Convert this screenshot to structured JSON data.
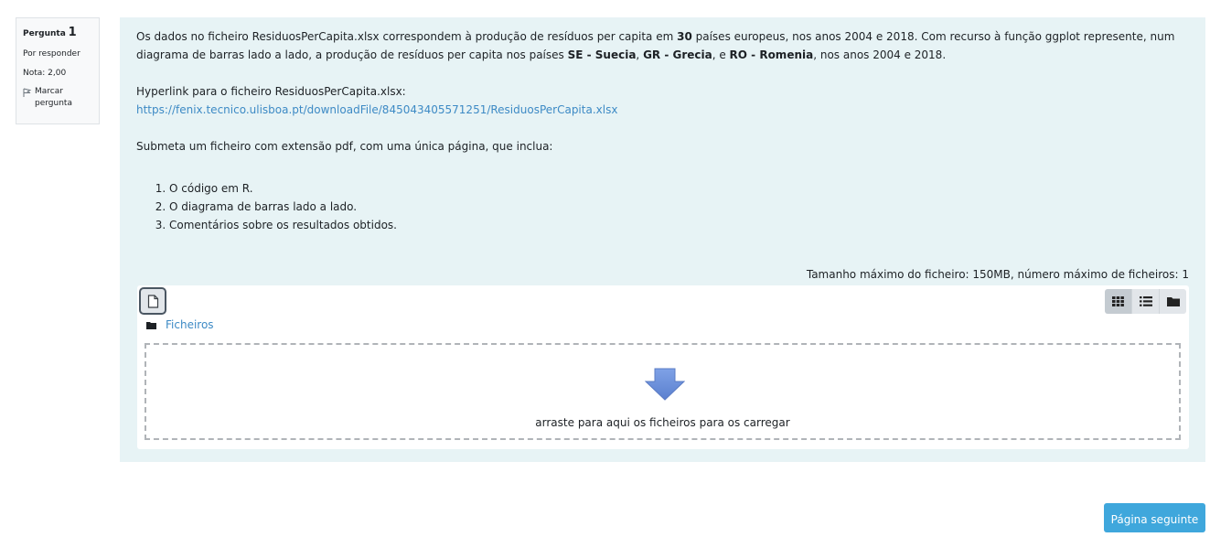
{
  "question_info": {
    "label": "Pergunta",
    "number": "1",
    "status": "Por responder",
    "grade": "Nota: 2,00",
    "flag_label": "Marcar pergunta"
  },
  "question_text": {
    "para1_part1": "Os dados no ficheiro ResiduosPerCapita.xlsx correspondem à produção de resíduos per capita em ",
    "para1_bold1": "30",
    "para1_part2": " países europeus, nos anos 2004 e 2018. Com recurso à função ggplot represente, num diagrama de barras lado a lado, a produção de resíduos per capita nos países ",
    "para1_bold2": "SE - Suecia",
    "para1_sep1": ", ",
    "para1_bold3": "GR - Grecia",
    "para1_sep2": ", e ",
    "para1_bold4": "RO - Romenia",
    "para1_part3": ", nos anos 2004 e 2018.",
    "hyperlink_label": "Hyperlink para o ficheiro ResiduosPerCapita.xlsx:",
    "hyperlink_url": "https://fenix.tecnico.ulisboa.pt/downloadFile/845043405571251/ResiduosPerCapita.xlsx",
    "submit_instructions": "Submeta um ficheiro com extensão pdf, com uma única página, que inclua:",
    "items": [
      "O código em R.",
      "O diagrama de barras lado a lado.",
      "Comentários sobre os resultados obtidos."
    ]
  },
  "file_limits": "Tamanho máximo do ficheiro: 150MB, número máximo de ficheiros: 1",
  "filemanager": {
    "add_file_icon": "file-icon",
    "view_buttons": [
      "grid-view-icon",
      "list-view-icon",
      "folder-view-icon"
    ],
    "breadcrumb_icon": "folder-icon",
    "breadcrumb_label": "Ficheiros",
    "drop_icon": "down-arrow-icon",
    "drop_text": "arraste para aqui os ficheiros para os carregar"
  },
  "navigation": {
    "next_button": "Página seguinte"
  },
  "colors": {
    "content_bg": "#e7f3f5",
    "link": "#3d8ac5",
    "next_button_bg": "#3fa7dc",
    "arrow": "#6a8ed6"
  }
}
